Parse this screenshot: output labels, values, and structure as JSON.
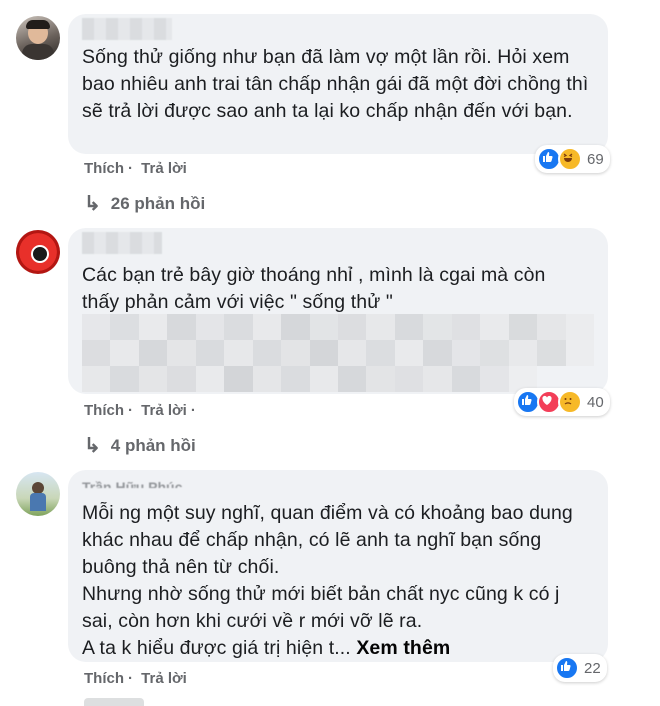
{
  "comments": [
    {
      "text": "Sống thử giống như bạn đã làm vợ một lần rồi. Hỏi xem bao nhiêu anh trai tân chấp nhận gái đã một đời chồng thì sẽ trả lời được sao anh ta lại ko chấp nhận đến với bạn.",
      "like_label": "Thích",
      "reply_label": "Trả lời",
      "reaction_count": "69",
      "reaction_icons": [
        "like-icon",
        "haha-icon"
      ],
      "replies_label": "26 phản hồi"
    },
    {
      "text_lines": [
        "Các bạn trẻ bây giờ thoáng nhỉ , mình là cgai mà còn",
        "thấy phản cảm với việc \" sống thử \""
      ],
      "like_label": "Thích",
      "reply_label": "Trả lời",
      "reaction_count": "40",
      "reaction_icons": [
        "like-icon",
        "love-icon",
        "sad-icon"
      ],
      "replies_label": "4 phản hồi"
    },
    {
      "name_partial": "Trần Hữu Phúc",
      "paragraphs": [
        "Mỗi ng một suy nghĩ, quan điểm và có khoảng bao dung khác nhau để chấp nhận, có lẽ anh ta nghĩ bạn sống buông thả nên từ chối.",
        "Nhưng nhờ sống thử mới biết bản chất nyc cũng k có j sai, còn hơn khi cưới về r mới vỡ lẽ ra.",
        "A ta k hiểu được giá trị hiện t..."
      ],
      "see_more": "Xem thêm",
      "like_label": "Thích",
      "reply_label": "Trả lời",
      "reaction_count": "22",
      "reaction_icons": [
        "like-icon"
      ]
    }
  ],
  "colors": {
    "bubble": "#f0f2f5",
    "meta": "#65676b",
    "like_blue": "#1877f2"
  }
}
